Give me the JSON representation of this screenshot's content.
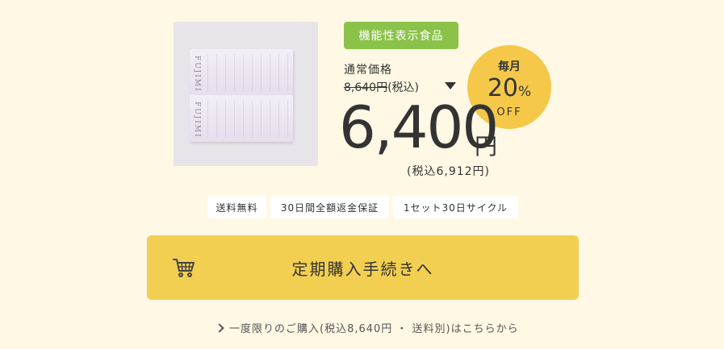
{
  "product": {
    "image_alt": "FUJIMI product package",
    "brand_text": "FUJIMI"
  },
  "badge": {
    "label": "機能性表示食品"
  },
  "pricing": {
    "regular_label": "通常価格",
    "regular_price": "8,640円",
    "regular_tax_note": "(税込)",
    "main_price": "6,400",
    "main_unit": "円",
    "tax_included": "(税込6,912円)"
  },
  "discount": {
    "monthly": "毎月",
    "percent": "20",
    "percent_unit": "%",
    "off": "OFF"
  },
  "tags": [
    {
      "label": "送料無料"
    },
    {
      "label": "30日間全額返金保証"
    },
    {
      "label": "1セット30日サイクル"
    }
  ],
  "cta": {
    "label": "定期購入手続きへ"
  },
  "single_purchase": {
    "label": "一度限りのご購入(税込8,640円 ・ 送料別)はこちらから"
  },
  "colors": {
    "background": "#fff8e4",
    "badge_green": "#8bc34a",
    "accent_yellow": "#f3cf51",
    "circle_yellow": "#f5c84a"
  }
}
